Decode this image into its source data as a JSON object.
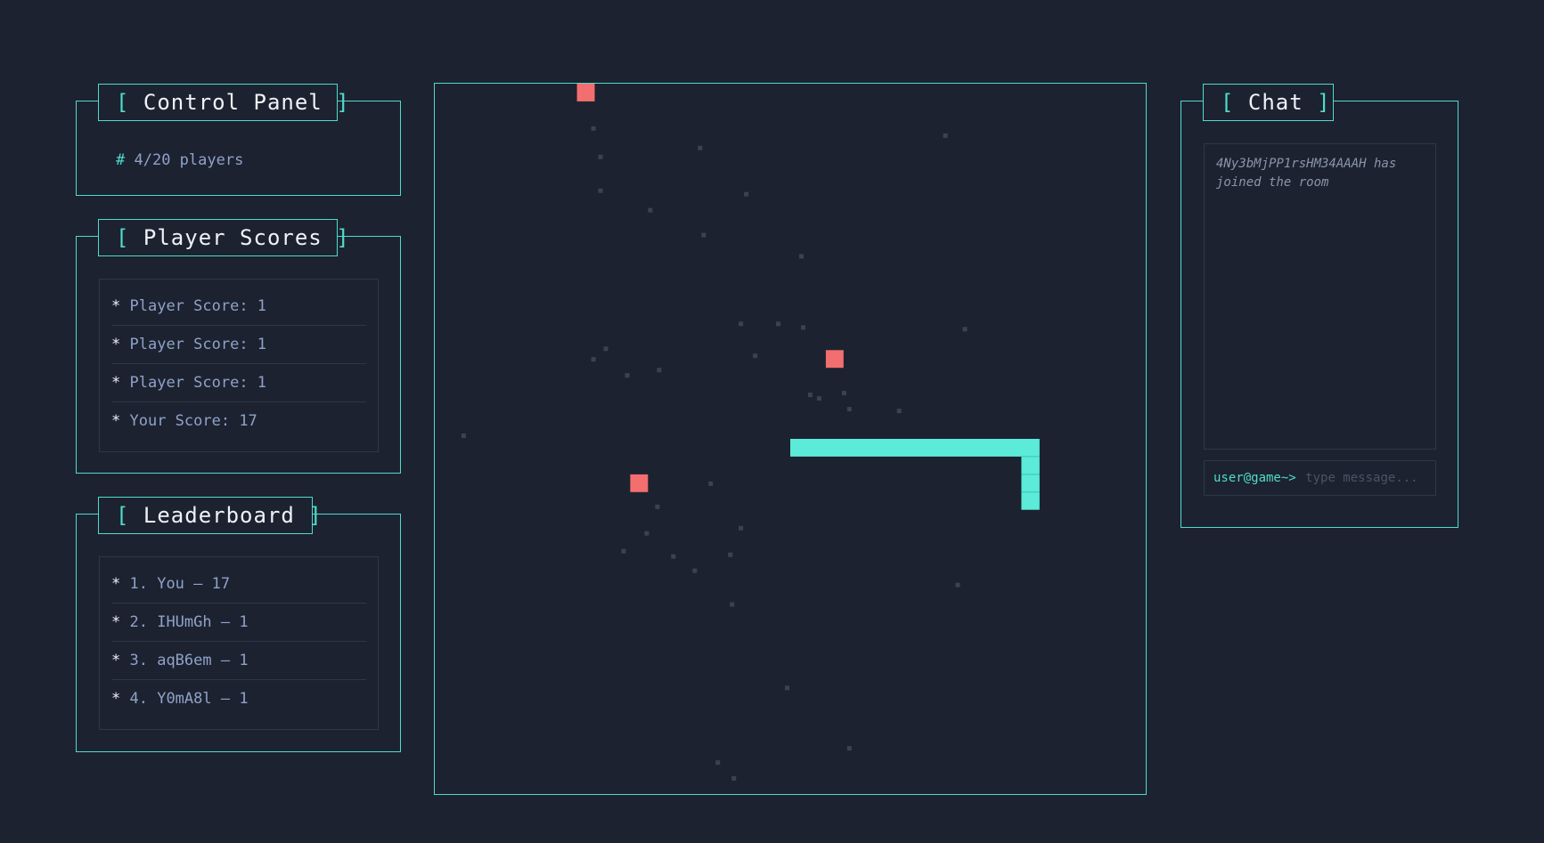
{
  "control_panel": {
    "title": "Control Panel",
    "bracket_open": "[",
    "bracket_close": "]",
    "hash": "#",
    "player_count": "4/20 players"
  },
  "player_scores": {
    "title": "Player Scores",
    "bracket_open": "[",
    "bracket_close": "]",
    "items": [
      {
        "bullet": "*",
        "label": "Player Score: 1"
      },
      {
        "bullet": "*",
        "label": "Player Score: 1"
      },
      {
        "bullet": "*",
        "label": "Player Score: 1"
      },
      {
        "bullet": "*",
        "label": "Your Score: 17"
      }
    ]
  },
  "leaderboard": {
    "title": "Leaderboard",
    "bracket_open": "[",
    "bracket_close": "]",
    "items": [
      {
        "bullet": "*",
        "label": "1. You – 17"
      },
      {
        "bullet": "*",
        "label": "2. IHUmGh – 1"
      },
      {
        "bullet": "*",
        "label": "3. aqB6em – 1"
      },
      {
        "bullet": "*",
        "label": "4. Y0mA8l – 1"
      }
    ]
  },
  "chat": {
    "title": "Chat",
    "bracket_open": "[",
    "bracket_close": "]",
    "messages": [
      {
        "text": "4Ny3bMjPP1rsHM34AAAH has joined the room"
      }
    ],
    "prompt": "user@game~>",
    "input_value": "",
    "input_placeholder": "type message..."
  },
  "game": {
    "grid_cells": 40,
    "colors": {
      "background": "#1c2230",
      "border": "#4fdccb",
      "snake": "#5cebd8",
      "snake_segment_line": "#3fbfaf",
      "food": "#f36f6f",
      "particle": "#3a4352"
    },
    "snake_cells": [
      [
        20,
        20
      ],
      [
        21,
        20
      ],
      [
        22,
        20
      ],
      [
        23,
        20
      ],
      [
        24,
        20
      ],
      [
        25,
        20
      ],
      [
        26,
        20
      ],
      [
        27,
        20
      ],
      [
        28,
        20
      ],
      [
        29,
        20
      ],
      [
        30,
        20
      ],
      [
        31,
        20
      ],
      [
        32,
        20
      ],
      [
        33,
        20
      ],
      [
        33,
        21
      ],
      [
        33,
        22
      ],
      [
        33,
        23
      ]
    ],
    "food_cells": [
      [
        8,
        0
      ],
      [
        22,
        15
      ],
      [
        11,
        22
      ]
    ],
    "particles": [
      [
        8.8,
        2.4
      ],
      [
        9.2,
        4.0
      ],
      [
        9.2,
        5.9
      ],
      [
        14.8,
        3.5
      ],
      [
        12.0,
        7.0
      ],
      [
        17.4,
        6.1
      ],
      [
        15.0,
        8.4
      ],
      [
        20.5,
        9.6
      ],
      [
        28.6,
        2.8
      ],
      [
        17.1,
        13.4
      ],
      [
        19.2,
        13.4
      ],
      [
        20.6,
        13.6
      ],
      [
        9.5,
        14.8
      ],
      [
        8.8,
        15.4
      ],
      [
        10.7,
        16.3
      ],
      [
        12.5,
        16.0
      ],
      [
        17.9,
        15.2
      ],
      [
        29.7,
        13.7
      ],
      [
        21.0,
        17.4
      ],
      [
        21.5,
        17.6
      ],
      [
        22.9,
        17.3
      ],
      [
        23.2,
        18.2
      ],
      [
        26.0,
        18.3
      ],
      [
        1.5,
        19.7
      ],
      [
        15.4,
        22.4
      ],
      [
        12.4,
        23.7
      ],
      [
        17.1,
        24.9
      ],
      [
        11.8,
        25.2
      ],
      [
        10.5,
        26.2
      ],
      [
        13.3,
        26.5
      ],
      [
        16.5,
        26.4
      ],
      [
        14.5,
        27.3
      ],
      [
        29.3,
        28.1
      ],
      [
        16.6,
        29.2
      ],
      [
        19.7,
        33.9
      ],
      [
        15.8,
        38.1
      ],
      [
        16.7,
        39.0
      ],
      [
        23.2,
        37.3
      ]
    ]
  }
}
